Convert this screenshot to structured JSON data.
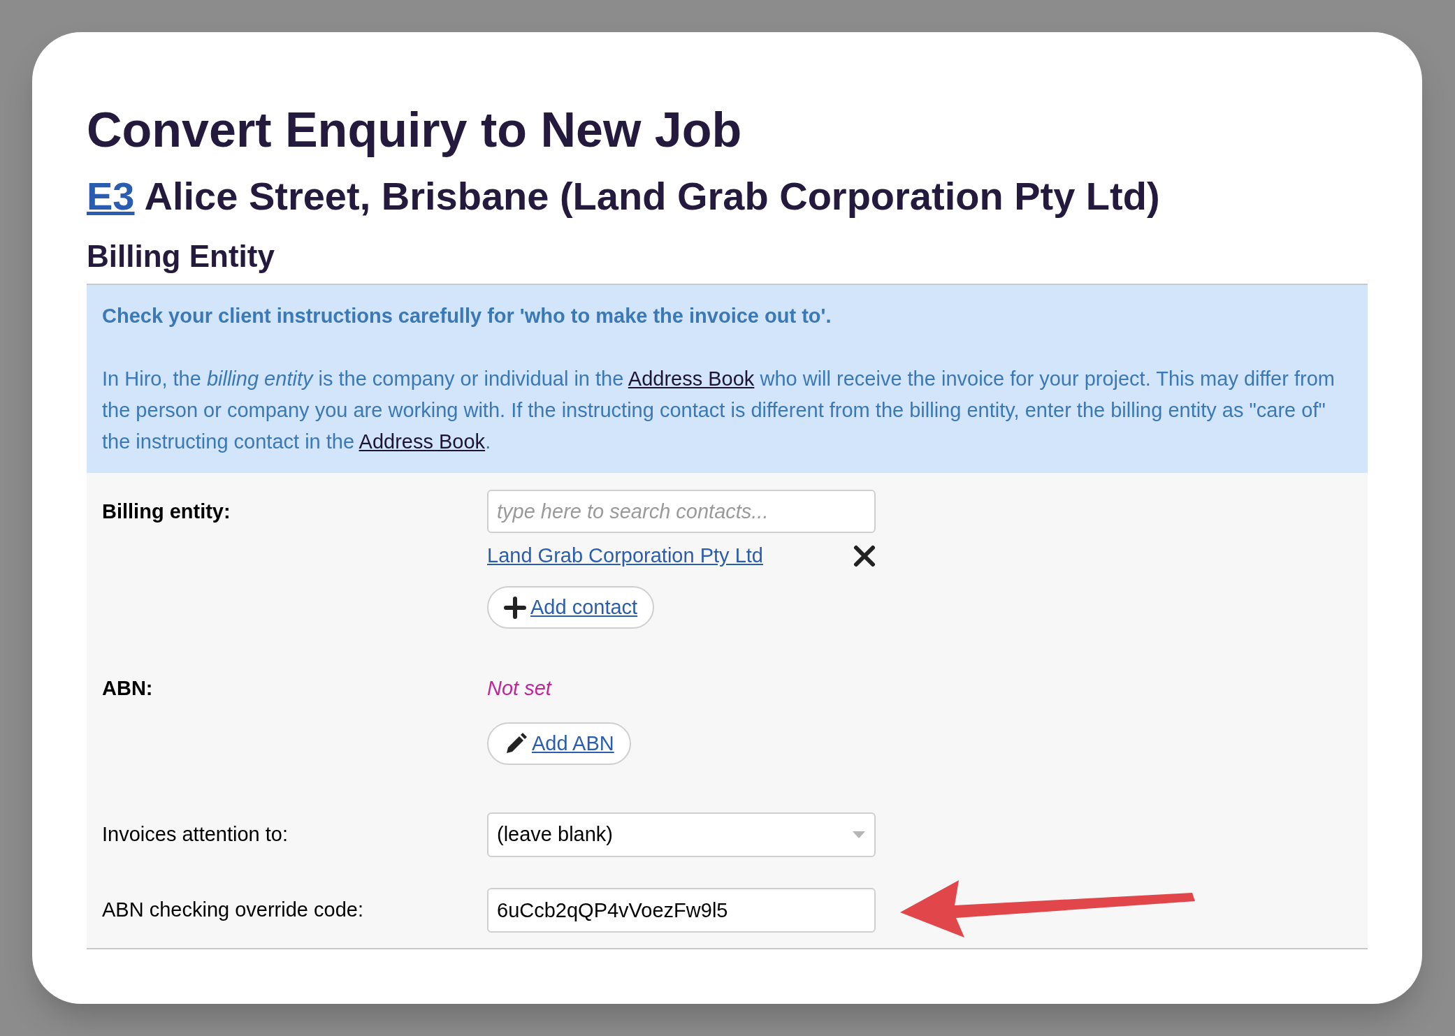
{
  "title": "Convert Enquiry to New Job",
  "subtitle": {
    "link": "E3",
    "text": "Alice Street, Brisbane (Land Grab Corporation Pty Ltd)"
  },
  "section_heading": "Billing Entity",
  "notice": {
    "headline": "Check your client instructions carefully for 'who to make the invoice out to'.",
    "paragraph": [
      {
        "kind": "text",
        "text": "In Hiro, the *billing entity* is the company or individual in the"
      },
      {
        "kind": "link",
        "text": "Address Book"
      },
      {
        "kind": "text",
        "text": "who will receive the invoice for your project. This may differ from the person or company you are working with. If the instructing contact is different from the billing entity, enter the billing entity as \"care of\" the instructing contact in the"
      },
      {
        "kind": "link",
        "text": "Address Book"
      },
      {
        "kind": "text",
        "text": "."
      }
    ]
  },
  "billing_entity": {
    "label": "Billing entity:",
    "placeholder": "type here to search contacts...",
    "selected_contact": "Land Grab Corporation Pty Ltd",
    "add_button": "Add contact"
  },
  "abn": {
    "label": "ABN:",
    "value": "Not set",
    "add_button": "Add ABN"
  },
  "invoices_attention": {
    "label": "Invoices attention to:",
    "value": "(leave blank)"
  },
  "override_code": {
    "label": "ABN checking override code:",
    "value": "6uCcb2qQP4vVoezFw9l5"
  }
}
